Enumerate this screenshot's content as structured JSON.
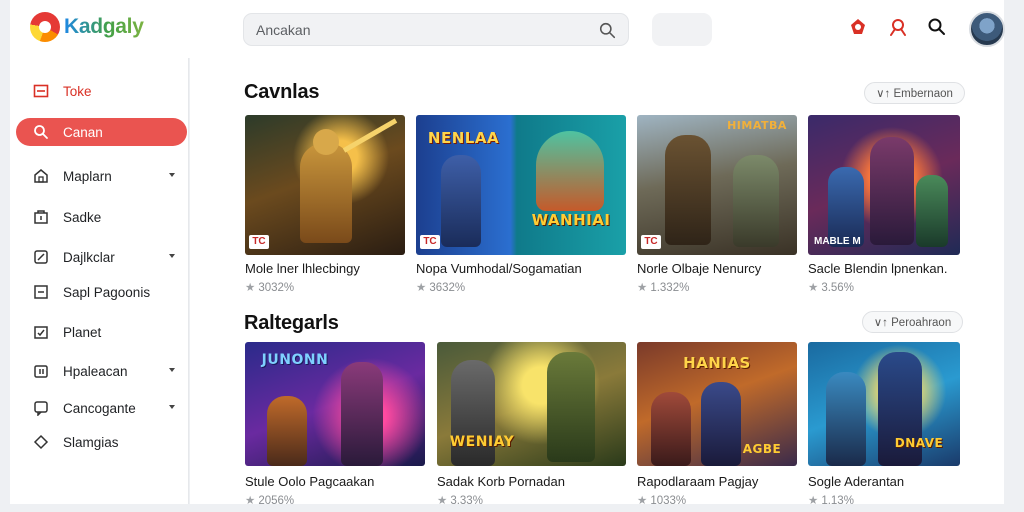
{
  "header": {
    "logo_text": "Kadgaly",
    "search_placeholder": "Ancakan",
    "icons": [
      "notification-icon",
      "user-icon",
      "search-icon",
      "avatar"
    ]
  },
  "sidebar": {
    "items": [
      {
        "label": "Toke",
        "icon": "home-icon"
      },
      {
        "label": "Canan",
        "icon": "search-icon"
      },
      {
        "label": "Maplarn",
        "icon": "house-icon"
      },
      {
        "label": "Sadke",
        "icon": "store-icon"
      },
      {
        "label": "Dajlkclar",
        "icon": "compass-icon"
      },
      {
        "label": "Sapl Pagoonis",
        "icon": "window-icon"
      },
      {
        "label": "Planet",
        "icon": "calendar-icon"
      },
      {
        "label": "Hpaleacan",
        "icon": "clipboard-icon"
      },
      {
        "label": "Cancogante",
        "icon": "chat-icon"
      },
      {
        "label": "Slamgias",
        "icon": "diamond-icon"
      }
    ]
  },
  "sections": [
    {
      "title": "Cavnlas",
      "sort_label": "∨↑ Embernaon",
      "cards": [
        {
          "title": "Mole lner lhlecbingy",
          "meta": "3032%",
          "badge": "TC"
        },
        {
          "title": "Nopa Vumhodal/Sogamatian",
          "meta": "3632%",
          "badge": "TC"
        },
        {
          "title": "Norle Olbaje Nenurcy",
          "meta": "1.332%",
          "badge": "TC"
        },
        {
          "title": "Sacle Blendin lpnenkan.",
          "meta": "3.56%",
          "badge": "MABLE M"
        }
      ]
    },
    {
      "title": "Raltegarls",
      "sort_label": "∨↑ Peroahraon",
      "cards": [
        {
          "title": "Stule Oolo Pagcaakan",
          "meta": "2056%",
          "badge": ""
        },
        {
          "title": "Sadak Korb Pornadan",
          "meta": "3.33%",
          "badge": ""
        },
        {
          "title": "Rapodlaraam Pagjay",
          "meta": "1033%",
          "badge": ""
        },
        {
          "title": "Sogle Aderantan",
          "meta": "1.13%",
          "badge": ""
        }
      ]
    }
  ],
  "colors": {
    "accent": "#ea5450",
    "home_label": "#d93025",
    "panel_bg": "#ffffff",
    "page_bg": "#eef0f3"
  }
}
